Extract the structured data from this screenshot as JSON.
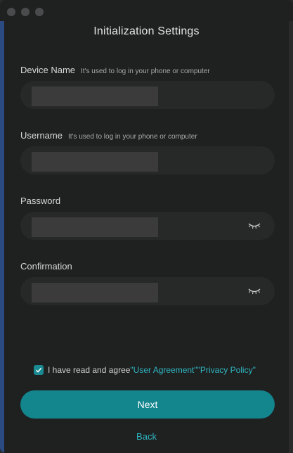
{
  "window": {
    "title": "Initialization Settings"
  },
  "fields": {
    "device_name": {
      "label": "Device Name",
      "hint": "It's used to log in your phone or computer"
    },
    "username": {
      "label": "Username",
      "hint": "It's used to log in your phone or computer"
    },
    "password": {
      "label": "Password",
      "toggle_icon": "eye-closed-icon"
    },
    "confirmation": {
      "label": "Confirmation",
      "toggle_icon": "eye-closed-icon"
    }
  },
  "agreement": {
    "checked": true,
    "text": "I have read and agree",
    "user_agreement": "\"User Agreement\"",
    "privacy_policy": "\"Privacy Policy\""
  },
  "actions": {
    "next_label": "Next",
    "back_label": "Back"
  },
  "colors": {
    "accent": "#13858d",
    "link": "#2fb6c2",
    "background": "#1f2020"
  }
}
